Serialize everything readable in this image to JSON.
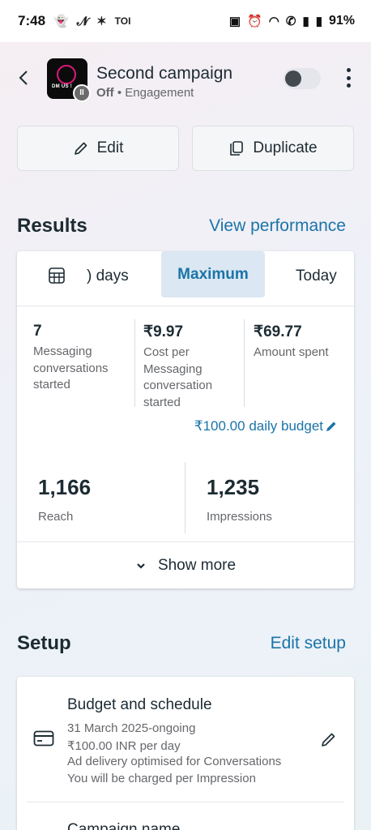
{
  "status_bar": {
    "time": "7:48",
    "left_icons": [
      "snapchat-icon",
      "news-icon",
      "sparkle-icon",
      "toi-icon"
    ],
    "toi_label": "TOI",
    "battery": "91%"
  },
  "header": {
    "title": "Second campaign",
    "status": "Off",
    "separator": "•",
    "objective": "Engagement",
    "thumb_text": "DM US !",
    "toggle_on": false
  },
  "actions": {
    "edit_label": "Edit",
    "duplicate_label": "Duplicate"
  },
  "results": {
    "title": "Results",
    "link": "View performance",
    "tabs": {
      "days": ") days",
      "maximum": "Maximum",
      "today": "Today",
      "selected": "Maximum"
    },
    "metrics": [
      {
        "value": "7",
        "label": "Messaging conversations started"
      },
      {
        "value": "₹9.97",
        "label": "Cost per Messaging conversation started"
      },
      {
        "value": "₹69.77",
        "label": "Amount spent"
      }
    ],
    "budget": "₹100.00 daily budget",
    "reach": {
      "value": "1,166",
      "label": "Reach"
    },
    "impressions": {
      "value": "1,235",
      "label": "Impressions"
    },
    "show_more": "Show more"
  },
  "setup": {
    "title": "Setup",
    "link": "Edit setup",
    "budget_schedule": {
      "title": "Budget and schedule",
      "lines": [
        "31 March 2025-ongoing",
        "₹100.00 INR per day",
        "Ad delivery optimised for Conversations",
        "You will be charged per Impression"
      ]
    },
    "next_item": "Campaign name"
  },
  "colors": {
    "accent": "#1b74a8",
    "text": "#1c2b33",
    "muted": "#65676b",
    "tab_selected_bg": "#dbe7f2"
  }
}
